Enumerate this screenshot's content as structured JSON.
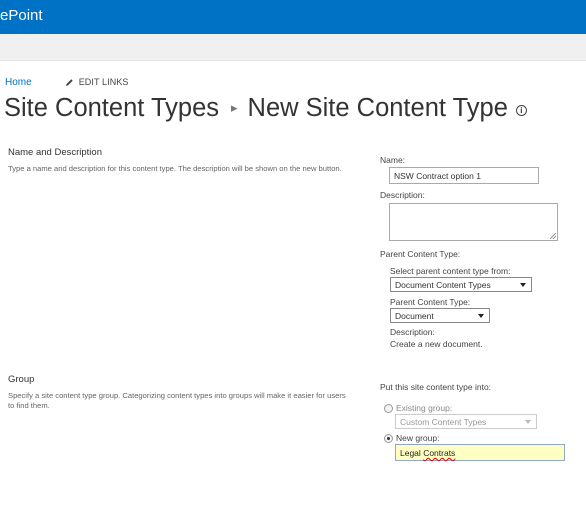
{
  "suite_bar": {
    "brand": "ePoint",
    "color": "#0072c6"
  },
  "top_nav": {
    "home": "Home",
    "edit_links": "EDIT LINKS"
  },
  "title": {
    "parent": "Site Content Types",
    "current": "New Site Content Type",
    "info_glyph": "i"
  },
  "name_section": {
    "title": "Name and Description",
    "description": "Type a name and description for this content type. The description will be shown on the new button.",
    "name_label": "Name:",
    "name_value": "NSW Contract option 1",
    "description_label": "Description:",
    "description_value": "",
    "parent_label": "Parent Content Type:",
    "select_from_label": "Select parent content type from:",
    "select_from_value": "Document Content Types",
    "parent_type_label": "Parent Content Type:",
    "parent_type_value": "Document",
    "parent_desc_label": "Description:",
    "parent_desc_value": "Create a new document."
  },
  "group_section": {
    "title": "Group",
    "description_line1": "Specify a site content type group. Categorizing content types into groups will make it easier for users",
    "description_line2": "to find them.",
    "put_into_label": "Put this site content type into:",
    "existing_group_label": "Existing group:",
    "existing_group_value": "Custom Content Types",
    "existing_selected": false,
    "new_group_label": "New group:",
    "new_group_value_part1": "Legal",
    "new_group_value_part2": "Contrats",
    "new_selected": true
  }
}
